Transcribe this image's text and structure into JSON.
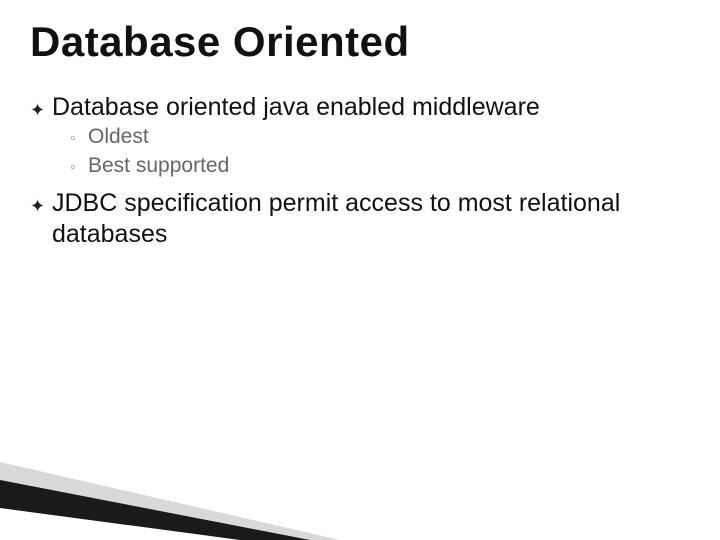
{
  "title": "Database Oriented",
  "bullets": [
    {
      "text": "Database oriented java enabled middleware",
      "subs": [
        "Oldest",
        "Best supported"
      ]
    },
    {
      "text": "JDBC specification permit access to most relational databases",
      "subs": []
    }
  ],
  "glyphs": {
    "bullet": "✦",
    "sub": "◦"
  }
}
